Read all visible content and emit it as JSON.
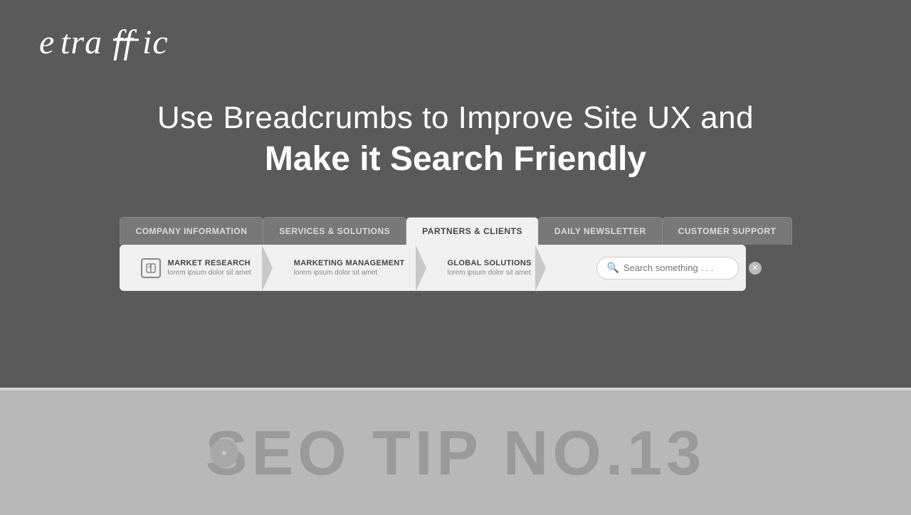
{
  "logo": {
    "text": "etraffic"
  },
  "headline": {
    "line1": "Use Breadcrumbs to Improve Site UX and",
    "line2": "Make it Search Friendly"
  },
  "nav_tabs": [
    {
      "id": "company-info",
      "label": "COMPANY INFORMATION",
      "active": false
    },
    {
      "id": "services",
      "label": "SERVICES & SOLUTIONS",
      "active": false
    },
    {
      "id": "partners",
      "label": "PARTNERS & CLIENTS",
      "active": true
    },
    {
      "id": "daily-newsletter",
      "label": "DAILY NEWSLETTER",
      "active": false
    },
    {
      "id": "customer-support",
      "label": "CUSTOMER SUPPORT",
      "active": false
    }
  ],
  "subnav_items": [
    {
      "id": "market-research",
      "title": "MARKET RESEARCH",
      "subtitle": "lorem ipsum dolor sit amet",
      "has_icon": true
    },
    {
      "id": "marketing-management",
      "title": "MARKETING MANAGEMENT",
      "subtitle": "lorem ipsum dolor sit amet",
      "has_icon": false
    },
    {
      "id": "global-solutions",
      "title": "GLOBAL SOLUTIONS",
      "subtitle": "lorem ipsum dolor sit amet",
      "has_icon": false
    }
  ],
  "search": {
    "placeholder": "Search something . . ."
  },
  "seo_tip": {
    "text": "SEO TIP NO.13"
  }
}
